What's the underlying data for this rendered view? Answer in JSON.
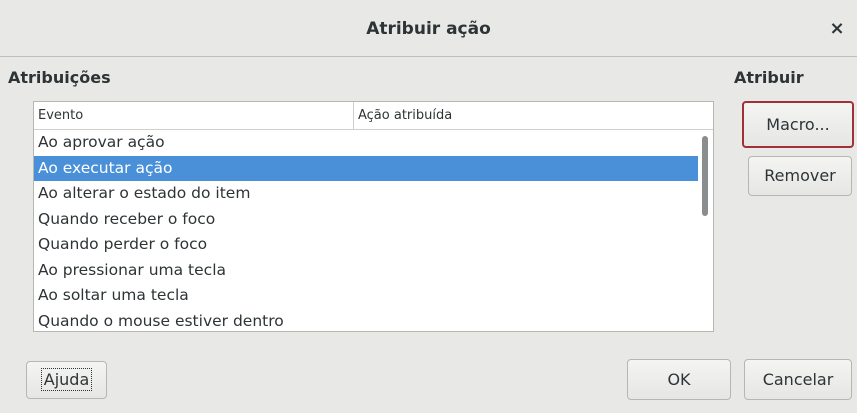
{
  "window": {
    "title": "Atribuir ação",
    "close_glyph": "×"
  },
  "assignments": {
    "heading": "Atribuições",
    "columns": [
      "Evento",
      "Ação atribuída"
    ],
    "events": [
      "Ao aprovar ação",
      "Ao executar ação",
      "Ao alterar o estado do item",
      "Quando receber o foco",
      "Quando perder o foco",
      "Ao pressionar uma tecla",
      "Ao soltar uma tecla",
      "Quando o mouse estiver dentro"
    ],
    "selected_index": 1
  },
  "assign": {
    "heading": "Atribuir",
    "macro_label": "Macro...",
    "remove_label": "Remover"
  },
  "footer": {
    "help_label": "Ajuda",
    "ok_label": "OK",
    "cancel_label": "Cancelar"
  },
  "colors": {
    "selection": "#4a90d9",
    "focus_border": "#a0303a"
  }
}
